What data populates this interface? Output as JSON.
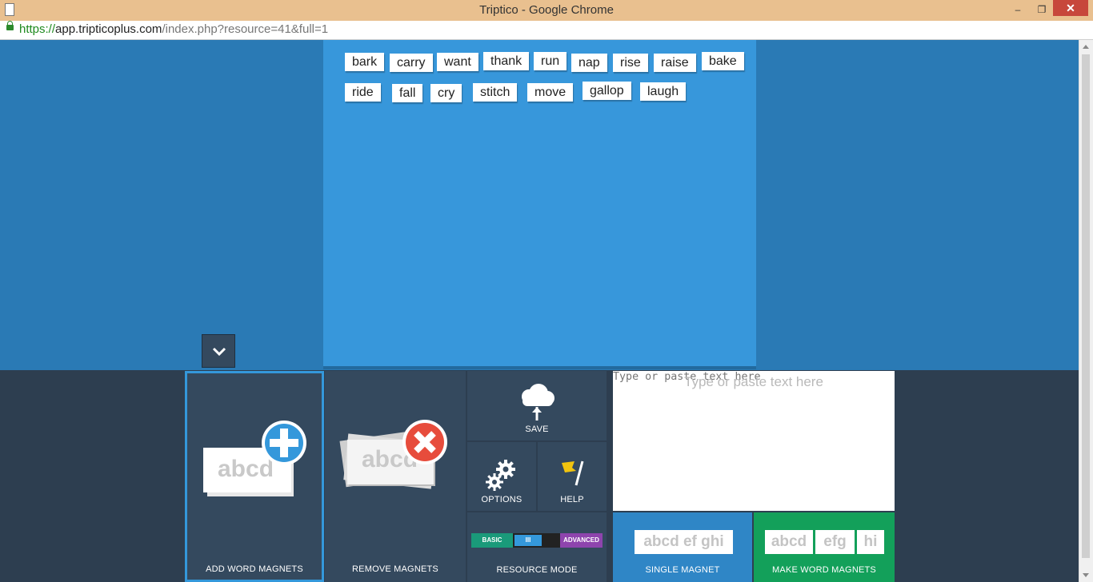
{
  "window": {
    "title": "Triptico - Google Chrome",
    "minimize_glyph": "–",
    "restore_glyph": "❐",
    "close_glyph": "✕"
  },
  "address_bar": {
    "url_scheme": "https://",
    "url_host": "app.tripticoplus.com",
    "url_path": "/index.php?resource=41&full=1"
  },
  "board": {
    "magnets": [
      "bark",
      "carry",
      "want",
      "thank",
      "run",
      "nap",
      "rise",
      "raise",
      "bake",
      "ride",
      "fall",
      "cry",
      "stitch",
      "move",
      "gallop",
      "laugh"
    ]
  },
  "toolbar": {
    "add_word_magnets": {
      "label": "ADD WORD MAGNETS",
      "card_text": "abcd"
    },
    "remove_magnets": {
      "label": "REMOVE MAGNETS",
      "card_text": "abcd"
    },
    "save": {
      "label": "SAVE"
    },
    "options": {
      "label": "OPTIONS"
    },
    "help": {
      "label": "HELP"
    },
    "resource_mode": {
      "label": "RESOURCE MODE",
      "basic": "BASIC",
      "slider": "III",
      "advanced": "ADVANCED"
    },
    "text_input": {
      "placeholder": "Type or paste text here",
      "value": ""
    },
    "single_magnet": {
      "label": "SINGLE MAGNET",
      "card_text": "abcd ef ghi"
    },
    "make_word_magnets": {
      "label": "MAKE WORD MAGNETS",
      "cards": [
        "abcd",
        "efg",
        "hi"
      ]
    }
  },
  "icons": {
    "collapse": "chevron-down-icon",
    "add": "plus-circle-icon",
    "remove": "x-circle-icon",
    "save": "cloud-upload-icon",
    "options": "gears-icon",
    "help": "flag-icon",
    "secure": "lock-icon"
  },
  "colors": {
    "page_bg": "#2a7ab5",
    "board_bg": "#3797db",
    "toolbar_bg": "#2d3e50",
    "tile_bg": "#34495e",
    "add_accent": "#3498db",
    "remove_accent": "#e74c3c",
    "single_magnet_bg": "#2f86c6",
    "make_magnets_bg": "#13a05a",
    "mode_basic": "#1a9a7a",
    "mode_advanced": "#8e44ad"
  }
}
